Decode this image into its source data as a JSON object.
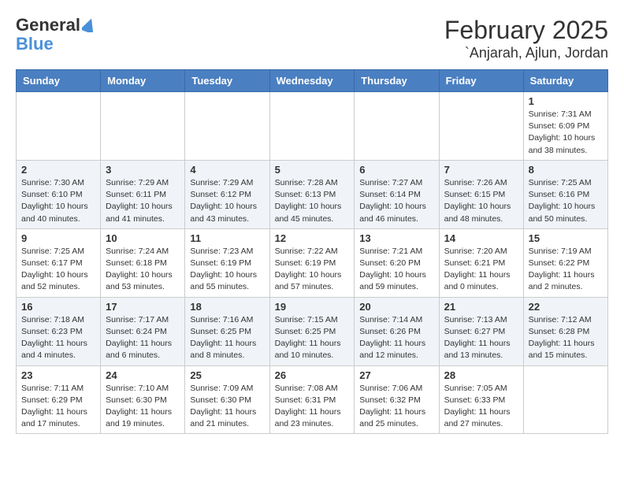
{
  "header": {
    "logo_line1": "General",
    "logo_line2": "Blue",
    "month": "February 2025",
    "location": "`Anjarah, Ajlun, Jordan"
  },
  "weekdays": [
    "Sunday",
    "Monday",
    "Tuesday",
    "Wednesday",
    "Thursday",
    "Friday",
    "Saturday"
  ],
  "weeks": [
    [
      {
        "day": "",
        "info": ""
      },
      {
        "day": "",
        "info": ""
      },
      {
        "day": "",
        "info": ""
      },
      {
        "day": "",
        "info": ""
      },
      {
        "day": "",
        "info": ""
      },
      {
        "day": "",
        "info": ""
      },
      {
        "day": "1",
        "info": "Sunrise: 7:31 AM\nSunset: 6:09 PM\nDaylight: 10 hours\nand 38 minutes."
      }
    ],
    [
      {
        "day": "2",
        "info": "Sunrise: 7:30 AM\nSunset: 6:10 PM\nDaylight: 10 hours\nand 40 minutes."
      },
      {
        "day": "3",
        "info": "Sunrise: 7:29 AM\nSunset: 6:11 PM\nDaylight: 10 hours\nand 41 minutes."
      },
      {
        "day": "4",
        "info": "Sunrise: 7:29 AM\nSunset: 6:12 PM\nDaylight: 10 hours\nand 43 minutes."
      },
      {
        "day": "5",
        "info": "Sunrise: 7:28 AM\nSunset: 6:13 PM\nDaylight: 10 hours\nand 45 minutes."
      },
      {
        "day": "6",
        "info": "Sunrise: 7:27 AM\nSunset: 6:14 PM\nDaylight: 10 hours\nand 46 minutes."
      },
      {
        "day": "7",
        "info": "Sunrise: 7:26 AM\nSunset: 6:15 PM\nDaylight: 10 hours\nand 48 minutes."
      },
      {
        "day": "8",
        "info": "Sunrise: 7:25 AM\nSunset: 6:16 PM\nDaylight: 10 hours\nand 50 minutes."
      }
    ],
    [
      {
        "day": "9",
        "info": "Sunrise: 7:25 AM\nSunset: 6:17 PM\nDaylight: 10 hours\nand 52 minutes."
      },
      {
        "day": "10",
        "info": "Sunrise: 7:24 AM\nSunset: 6:18 PM\nDaylight: 10 hours\nand 53 minutes."
      },
      {
        "day": "11",
        "info": "Sunrise: 7:23 AM\nSunset: 6:19 PM\nDaylight: 10 hours\nand 55 minutes."
      },
      {
        "day": "12",
        "info": "Sunrise: 7:22 AM\nSunset: 6:19 PM\nDaylight: 10 hours\nand 57 minutes."
      },
      {
        "day": "13",
        "info": "Sunrise: 7:21 AM\nSunset: 6:20 PM\nDaylight: 10 hours\nand 59 minutes."
      },
      {
        "day": "14",
        "info": "Sunrise: 7:20 AM\nSunset: 6:21 PM\nDaylight: 11 hours\nand 0 minutes."
      },
      {
        "day": "15",
        "info": "Sunrise: 7:19 AM\nSunset: 6:22 PM\nDaylight: 11 hours\nand 2 minutes."
      }
    ],
    [
      {
        "day": "16",
        "info": "Sunrise: 7:18 AM\nSunset: 6:23 PM\nDaylight: 11 hours\nand 4 minutes."
      },
      {
        "day": "17",
        "info": "Sunrise: 7:17 AM\nSunset: 6:24 PM\nDaylight: 11 hours\nand 6 minutes."
      },
      {
        "day": "18",
        "info": "Sunrise: 7:16 AM\nSunset: 6:25 PM\nDaylight: 11 hours\nand 8 minutes."
      },
      {
        "day": "19",
        "info": "Sunrise: 7:15 AM\nSunset: 6:25 PM\nDaylight: 11 hours\nand 10 minutes."
      },
      {
        "day": "20",
        "info": "Sunrise: 7:14 AM\nSunset: 6:26 PM\nDaylight: 11 hours\nand 12 minutes."
      },
      {
        "day": "21",
        "info": "Sunrise: 7:13 AM\nSunset: 6:27 PM\nDaylight: 11 hours\nand 13 minutes."
      },
      {
        "day": "22",
        "info": "Sunrise: 7:12 AM\nSunset: 6:28 PM\nDaylight: 11 hours\nand 15 minutes."
      }
    ],
    [
      {
        "day": "23",
        "info": "Sunrise: 7:11 AM\nSunset: 6:29 PM\nDaylight: 11 hours\nand 17 minutes."
      },
      {
        "day": "24",
        "info": "Sunrise: 7:10 AM\nSunset: 6:30 PM\nDaylight: 11 hours\nand 19 minutes."
      },
      {
        "day": "25",
        "info": "Sunrise: 7:09 AM\nSunset: 6:30 PM\nDaylight: 11 hours\nand 21 minutes."
      },
      {
        "day": "26",
        "info": "Sunrise: 7:08 AM\nSunset: 6:31 PM\nDaylight: 11 hours\nand 23 minutes."
      },
      {
        "day": "27",
        "info": "Sunrise: 7:06 AM\nSunset: 6:32 PM\nDaylight: 11 hours\nand 25 minutes."
      },
      {
        "day": "28",
        "info": "Sunrise: 7:05 AM\nSunset: 6:33 PM\nDaylight: 11 hours\nand 27 minutes."
      },
      {
        "day": "",
        "info": ""
      }
    ]
  ]
}
